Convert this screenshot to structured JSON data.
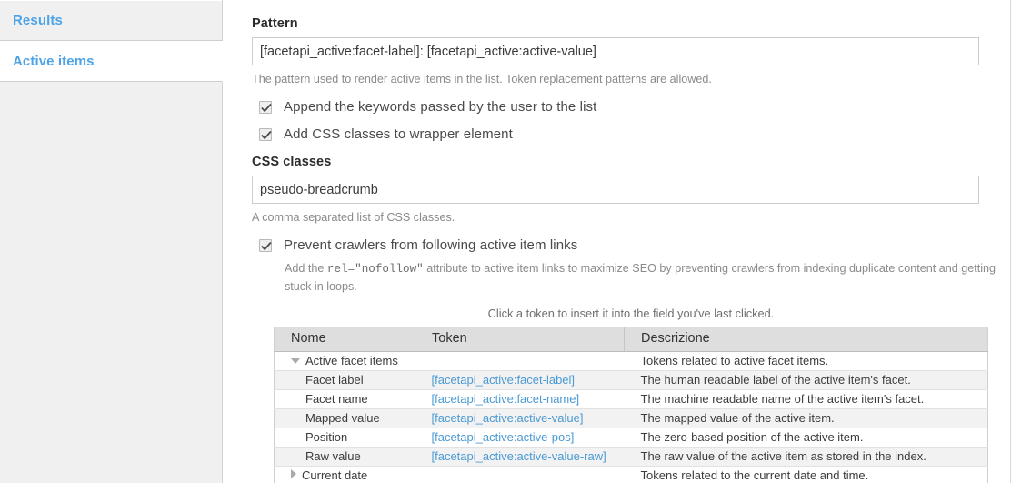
{
  "sidebar": {
    "tabs": [
      {
        "label": "Results",
        "active": false
      },
      {
        "label": "Active items",
        "active": true
      }
    ]
  },
  "form": {
    "pattern": {
      "label": "Pattern",
      "value": "[facetapi_active:facet-label]: [facetapi_active:active-value]",
      "description": "The pattern used to render active items in the list. Token replacement patterns are allowed."
    },
    "checkbox_append": {
      "label": "Append the keywords passed by the user to the list",
      "checked": true
    },
    "checkbox_css": {
      "label": "Add CSS classes to wrapper element",
      "checked": true
    },
    "css_classes": {
      "label": "CSS classes",
      "value": "pseudo-breadcrumb",
      "description": "A comma separated list of CSS classes."
    },
    "checkbox_nofollow": {
      "label": "Prevent crawlers from following active item links",
      "checked": true,
      "description_before": "Add the ",
      "description_code": "rel=\"nofollow\"",
      "description_after": " attribute to active item links to maximize SEO by preventing crawlers from indexing duplicate content and getting stuck in loops."
    }
  },
  "token_browser": {
    "hint": "Click a token to insert it into the field you've last clicked.",
    "columns": [
      "Nome",
      "Token",
      "Descrizione"
    ],
    "rows": [
      {
        "type": "group",
        "expanded": true,
        "name": "Active facet items",
        "token": "",
        "description": "Tokens related to active facet items."
      },
      {
        "type": "child",
        "name": "Facet label",
        "token": "[facetapi_active:facet-label]",
        "description": "The human readable label of the active item's facet."
      },
      {
        "type": "child",
        "name": "Facet name",
        "token": "[facetapi_active:facet-name]",
        "description": "The machine readable name of the active item's facet."
      },
      {
        "type": "child",
        "name": "Mapped value",
        "token": "[facetapi_active:active-value]",
        "description": "The mapped value of the active item."
      },
      {
        "type": "child",
        "name": "Position",
        "token": "[facetapi_active:active-pos]",
        "description": "The zero-based position of the active item."
      },
      {
        "type": "child",
        "name": "Raw value",
        "token": "[facetapi_active:active-value-raw]",
        "description": "The raw value of the active item as stored in the index."
      },
      {
        "type": "group",
        "expanded": false,
        "name": "Current date",
        "token": "",
        "description": "Tokens related to the current date and time."
      }
    ]
  },
  "colors": {
    "tab_link": "#4da3e8",
    "token_link": "#4a9ad4",
    "sidebar_bg": "#f0f0f0",
    "table_header_bg": "#dedede",
    "row_stripe": "#f2f2f2"
  }
}
